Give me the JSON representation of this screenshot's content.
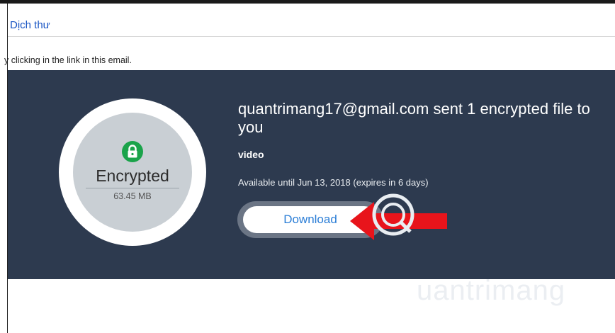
{
  "translate_bar": {
    "link_label": "Dịch thư"
  },
  "email": {
    "partial_text": "y clicking in the link in this email."
  },
  "badge": {
    "title": "Encrypted",
    "size": "63.45 MB"
  },
  "message": {
    "headline": "quantrimang17@gmail.com sent 1 encrypted file to you",
    "file_name": "video",
    "availability": "Available until Jun 13, 2018 (expires in 6 days)",
    "download_label": "Download"
  },
  "watermark": {
    "text": "uantrimang"
  },
  "colors": {
    "banner_bg": "#2d3a4f",
    "lock_badge": "#1aa34a",
    "download_text": "#2a7dd6",
    "arrow": "#e8141b",
    "link": "#1a56c4"
  },
  "icons": [
    "lock-icon",
    "arrow-pointer-icon",
    "watermark-logo-icon"
  ]
}
